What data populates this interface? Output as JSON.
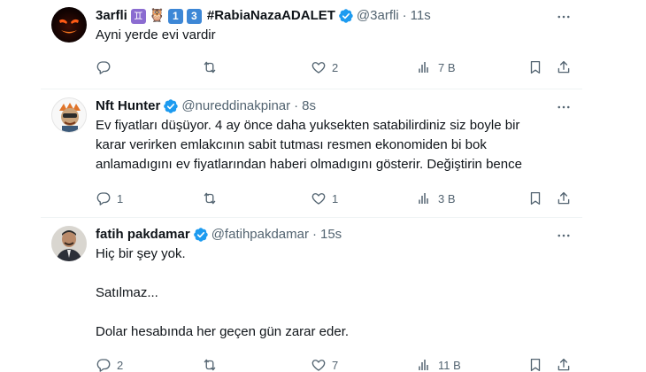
{
  "tweets": [
    {
      "name": "3arfli",
      "emojis": [
        "♊",
        "🦉",
        "1",
        "3"
      ],
      "hashtag": "#RabiaNazaADALET",
      "handle": "@3arfli",
      "time": "11s",
      "text": [
        "Ayni yerde evi vardir"
      ],
      "replies": "",
      "retweets": "",
      "likes": "2",
      "views": "7 B"
    },
    {
      "name": "Nft Hunter",
      "handle": "@nureddinakpinar",
      "time": "8s",
      "text": [
        "Ev fiyatları düşüyor. 4 ay önce daha yuksekten satabilirdiniz siz boyle bir",
        "karar verirken emlakcının sabit tutması resmen ekonomiden bi bok",
        "anlamadıgını ev fiyatlarından haberi olmadıgını gösterir. Değiştirin bence"
      ],
      "replies": "1",
      "retweets": "",
      "likes": "1",
      "views": "3 B"
    },
    {
      "name": "fatih pakdamar",
      "handle": "@fatihpakdamar",
      "time": "15s",
      "text": [
        "Hiç bir şey yok.",
        "",
        "Satılmaz...",
        "",
        "Dolar hesabında her geçen gün zarar eder."
      ],
      "replies": "2",
      "retweets": "",
      "likes": "7",
      "views": "11 B"
    }
  ],
  "colors": {
    "verified": "#1d9bf0",
    "text": "#0f1419",
    "secondary": "#536471",
    "divider": "#eff3f4"
  },
  "dot": "·"
}
